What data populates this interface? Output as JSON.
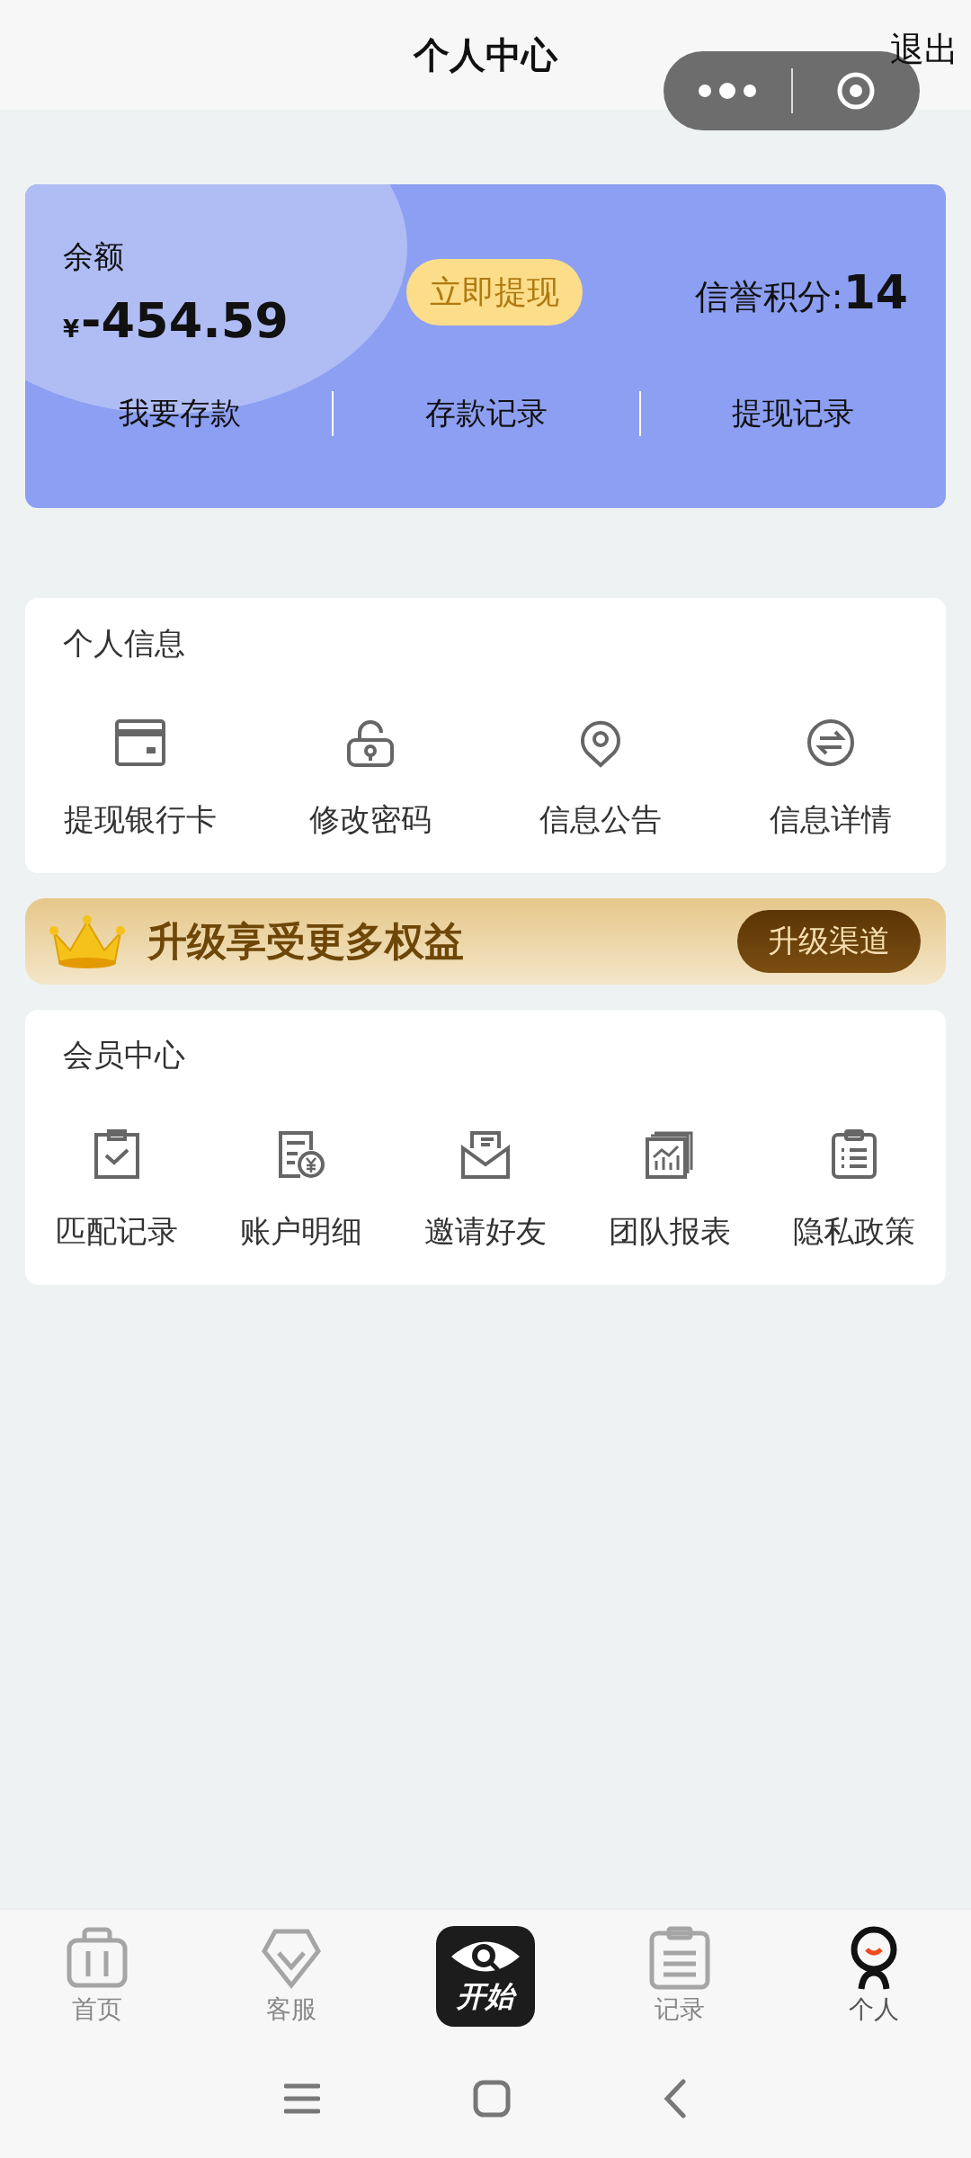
{
  "header": {
    "title": "个人中心",
    "logout": "退出"
  },
  "balance_card": {
    "label": "余额",
    "currency": "¥",
    "amount": "-454.59",
    "withdraw_button": "立即提现",
    "credit_label": "信誉积分:",
    "credit_value": "14",
    "links": [
      "我要存款",
      "存款记录",
      "提现记录"
    ]
  },
  "personal_info": {
    "title": "个人信息",
    "items": [
      {
        "label": "提现银行卡",
        "kind": "card"
      },
      {
        "label": "修改密码",
        "kind": "lock"
      },
      {
        "label": "信息公告",
        "kind": "pin"
      },
      {
        "label": "信息详情",
        "kind": "exchange"
      }
    ]
  },
  "upgrade_banner": {
    "text": "升级享受更多权益",
    "button": "升级渠道"
  },
  "member_center": {
    "title": "会员中心",
    "items": [
      {
        "label": "匹配记录",
        "kind": "check-clipboard"
      },
      {
        "label": "账户明细",
        "kind": "bill"
      },
      {
        "label": "邀请好友",
        "kind": "envelope"
      },
      {
        "label": "团队报表",
        "kind": "chart"
      },
      {
        "label": "隐私政策",
        "kind": "list-clipboard"
      }
    ]
  },
  "tab_bar": {
    "items": [
      {
        "label": "首页",
        "kind": "home",
        "selected": false
      },
      {
        "label": "客服",
        "kind": "diamond",
        "selected": false
      },
      {
        "label": "开始",
        "kind": "start",
        "selected": false
      },
      {
        "label": "记录",
        "kind": "record",
        "selected": false
      },
      {
        "label": "个人",
        "kind": "person",
        "selected": true
      }
    ]
  }
}
